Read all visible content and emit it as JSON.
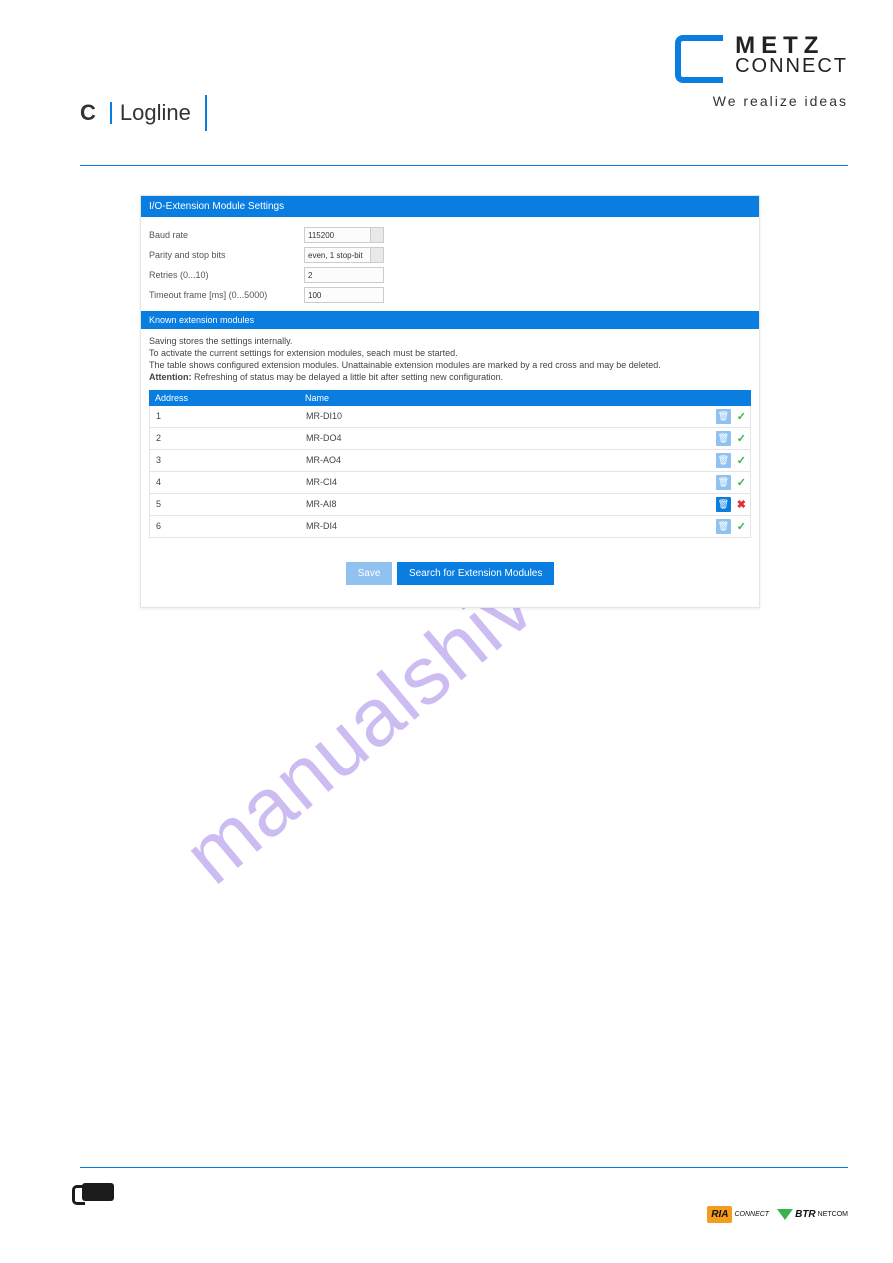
{
  "header": {
    "brand_line1": "METZ",
    "brand_line2": "CONNECT",
    "tagline": "We realize ideas",
    "logline_c": "C",
    "logline_text": "Logline"
  },
  "panel": {
    "title": "I/O-Extension Module Settings",
    "fields": {
      "baud_label": "Baud rate",
      "baud_value": "115200",
      "parity_label": "Parity and stop bits",
      "parity_value": "even, 1 stop-bit",
      "retries_label": "Retries (0...10)",
      "retries_value": "2",
      "timeout_label": "Timeout frame [ms] (0...5000)",
      "timeout_value": "100"
    },
    "subheader": "Known extension modules",
    "notes": {
      "n1": "Saving stores the settings internally.",
      "n2": "To activate the current settings for extension modules, seach must be started.",
      "n3": "The table shows configured extension modules. Unattainable extension modules are marked by a red cross and may be deleted.",
      "n4_bold": "Attention:",
      "n4_rest": " Refreshing of status may be delayed a little bit after setting new configuration."
    },
    "table": {
      "col_address": "Address",
      "col_name": "Name",
      "rows": [
        {
          "addr": "1",
          "name": "MR-DI10",
          "ok": true,
          "del_active": false
        },
        {
          "addr": "2",
          "name": "MR-DO4",
          "ok": true,
          "del_active": false
        },
        {
          "addr": "3",
          "name": "MR-AO4",
          "ok": true,
          "del_active": false
        },
        {
          "addr": "4",
          "name": "MR-CI4",
          "ok": true,
          "del_active": false
        },
        {
          "addr": "5",
          "name": "MR-AI8",
          "ok": false,
          "del_active": true
        },
        {
          "addr": "6",
          "name": "MR-DI4",
          "ok": true,
          "del_active": false
        }
      ]
    },
    "buttons": {
      "save": "Save",
      "search": "Search for Extension Modules"
    }
  },
  "watermark": "manualshive.com",
  "footer": {
    "ria_main": "RIA",
    "ria_sub": "CONNECT",
    "btr_main": "BTR",
    "btr_sub": "NETCOM"
  }
}
